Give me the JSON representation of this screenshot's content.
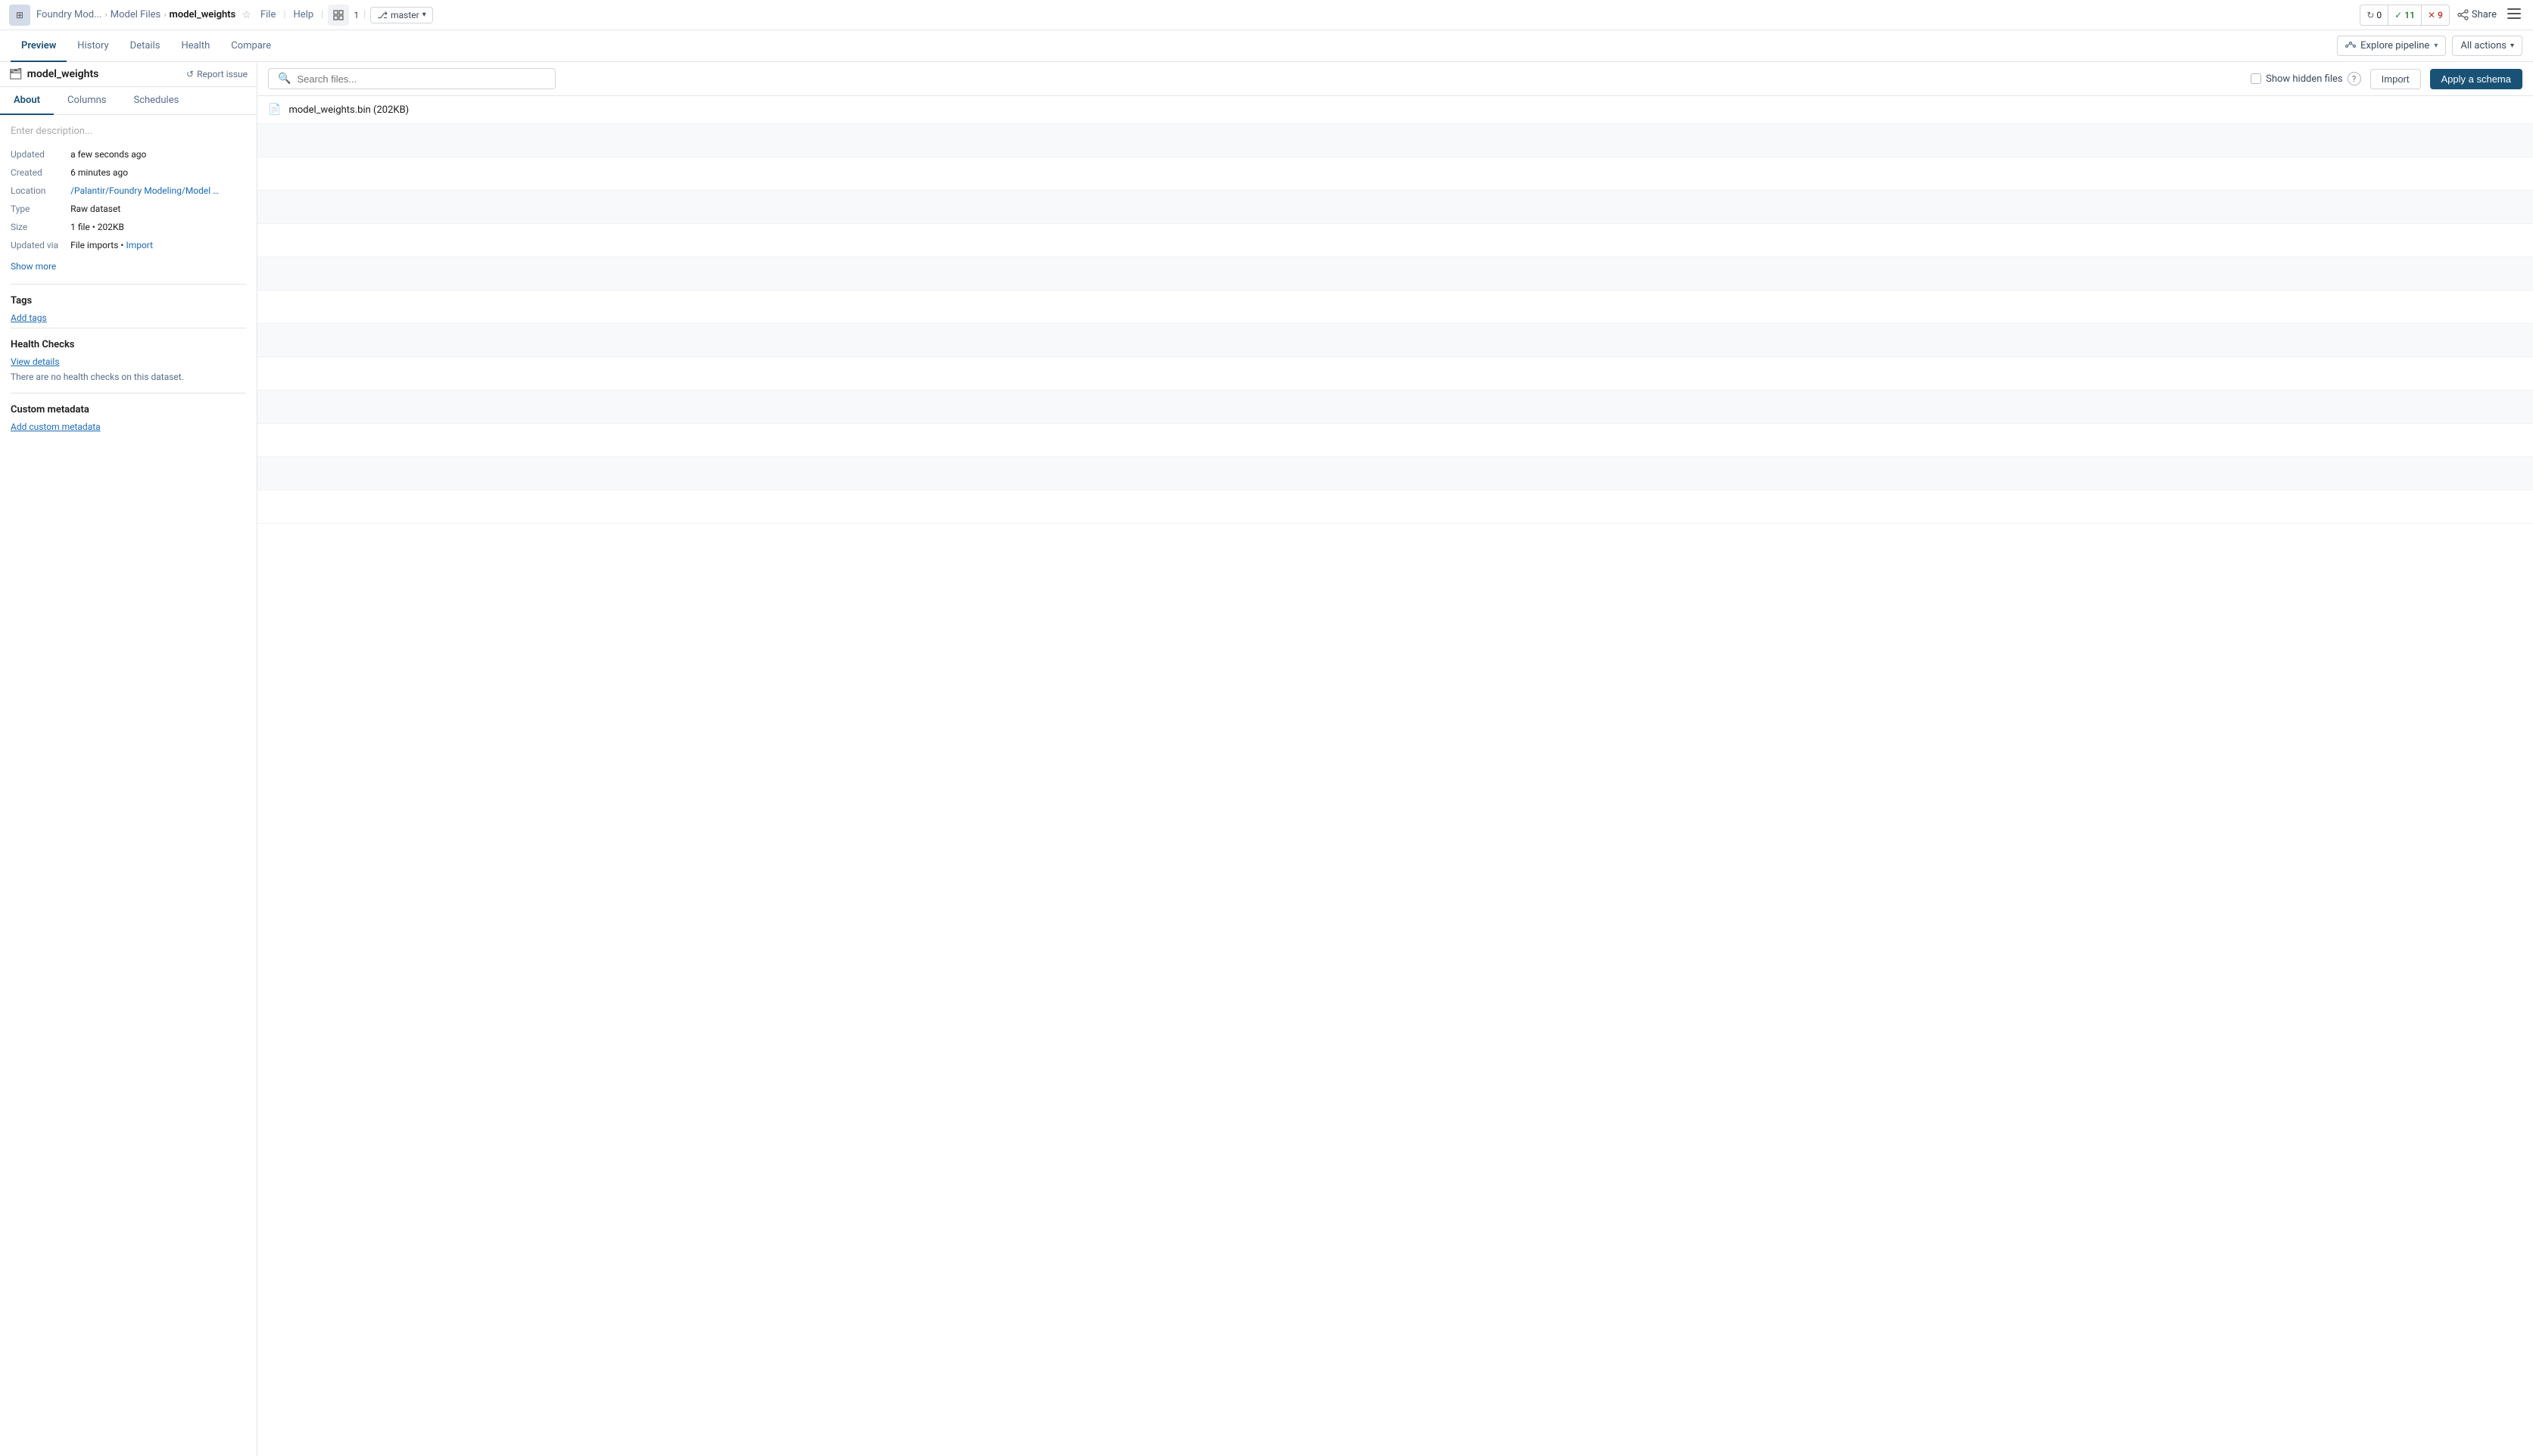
{
  "app": {
    "icon": "⊞"
  },
  "breadcrumb": {
    "items": [
      "Foundry Mod...",
      "Model Files"
    ],
    "current": "model_weights"
  },
  "topbar": {
    "file_label": "File",
    "help_label": "Help",
    "grid_count": "1",
    "branch_label": "master",
    "notifications": {
      "refresh_count": "0",
      "check_count": "11",
      "x_count": "9"
    },
    "share_label": "Share"
  },
  "tabs": {
    "items": [
      "Preview",
      "History",
      "Details",
      "Health",
      "Compare"
    ],
    "active": "Preview"
  },
  "explore_pipeline": {
    "label": "Explore pipeline"
  },
  "all_actions": {
    "label": "All actions"
  },
  "sidebar": {
    "title": "model_weights",
    "report_issue": "Report issue",
    "sub_tabs": [
      "About",
      "Columns",
      "Schedules"
    ],
    "active_sub_tab": "About",
    "description_placeholder": "Enter description...",
    "meta": {
      "updated_label": "Updated",
      "updated_value": "a few seconds ago",
      "created_label": "Created",
      "created_value": "6 minutes ago",
      "location_label": "Location",
      "location_value": "/Palantir/Foundry Modeling/Model Files/m...",
      "type_label": "Type",
      "type_value": "Raw dataset",
      "size_label": "Size",
      "size_value": "1 file • 202KB",
      "updated_via_label": "Updated via",
      "updated_via_value": "File imports •",
      "updated_via_link": "Import"
    },
    "show_more": "Show more",
    "tags_title": "Tags",
    "add_tags": "Add tags",
    "health_checks_title": "Health Checks",
    "view_details": "View details",
    "health_checks_text": "There are no health checks on this dataset.",
    "custom_metadata_title": "Custom metadata",
    "add_custom_metadata": "Add custom metadata"
  },
  "file_toolbar": {
    "search_placeholder": "Search files...",
    "show_hidden_label": "Show hidden files",
    "import_label": "Import",
    "apply_schema_label": "Apply a schema"
  },
  "files": [
    {
      "name": "model_weights.bin (202KB)",
      "icon": "📄"
    }
  ]
}
